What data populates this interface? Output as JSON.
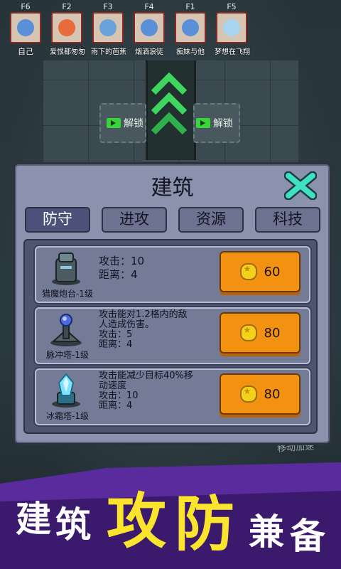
{
  "players": [
    {
      "key": "F6",
      "name": "自己",
      "color": "#5a90d8"
    },
    {
      "key": "F2",
      "name": "爱恨都匆匆",
      "color": "#e96a3a"
    },
    {
      "key": "F3",
      "name": "雨下的芭蕉",
      "color": "#6aa3d8"
    },
    {
      "key": "F4",
      "name": "烟酒浪徒",
      "color": "#5a90d8"
    },
    {
      "key": "F1",
      "name": "痴妹与他",
      "color": "#5a90d8"
    },
    {
      "key": "F5",
      "name": "梦想在飞翔",
      "color": "#a9d4f0"
    }
  ],
  "unlock_label": "解锁",
  "dialog": {
    "title": "建筑",
    "tabs": [
      "防守",
      "进攻",
      "资源",
      "科技"
    ],
    "active_tab": "防守",
    "items": [
      {
        "name": "猎魔炮台-1级",
        "desc": "",
        "attack": "攻击：10",
        "range": "距离：4",
        "price": "60"
      },
      {
        "name": "脉冲塔-1级",
        "desc1": "攻击能对1.2格内的敌",
        "desc2": "人造成伤害。",
        "attack": "攻击：5",
        "range": "距离：4",
        "price": "80"
      },
      {
        "name": "冰霜塔-1级",
        "desc1": "攻击能减少目标40%移",
        "desc2": "动速度",
        "attack": "攻击：10",
        "range": "距离：4",
        "price": "80"
      }
    ]
  },
  "side_hint": "移动加速",
  "banner": [
    "建",
    "筑",
    "攻",
    "防",
    "兼",
    "备"
  ],
  "colors": {
    "accent_green": "#3ed65f",
    "coin_button": "#f39210",
    "banner_yellow": "#fbe52c",
    "banner_purple": "#5a2b9c"
  }
}
